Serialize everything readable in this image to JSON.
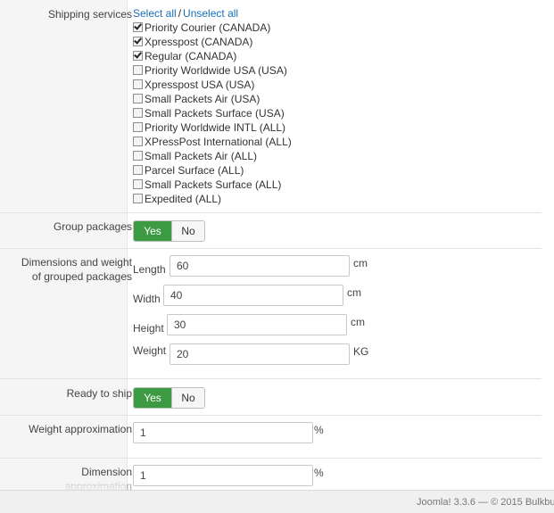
{
  "shipping_services": {
    "label": "Shipping services",
    "select_all": "Select all",
    "separator": "/",
    "unselect_all": "Unselect all",
    "items": [
      {
        "label": "Priority Courier (CANADA)",
        "checked": true
      },
      {
        "label": "Xpresspost (CANADA)",
        "checked": true
      },
      {
        "label": "Regular (CANADA)",
        "checked": true
      },
      {
        "label": "Priority Worldwide USA (USA)",
        "checked": false
      },
      {
        "label": "Xpresspost USA (USA)",
        "checked": false
      },
      {
        "label": "Small Packets Air (USA)",
        "checked": false
      },
      {
        "label": "Small Packets Surface (USA)",
        "checked": false
      },
      {
        "label": "Priority Worldwide INTL (ALL)",
        "checked": false
      },
      {
        "label": "XPressPost International (ALL)",
        "checked": false
      },
      {
        "label": "Small Packets Air (ALL)",
        "checked": false
      },
      {
        "label": "Parcel Surface (ALL)",
        "checked": false
      },
      {
        "label": "Small Packets Surface (ALL)",
        "checked": false
      },
      {
        "label": "Expedited (ALL)",
        "checked": false
      }
    ]
  },
  "group_packages": {
    "label": "Group packages",
    "yes": "Yes",
    "no": "No",
    "selected": "Yes"
  },
  "dimensions": {
    "label_line1": "Dimensions and weight",
    "label_line2": "of grouped packages",
    "length_label": "Length",
    "length_value": "60",
    "length_unit": "cm",
    "width_label": "Width",
    "width_value": "40",
    "width_unit": "cm",
    "height_label": "Height",
    "height_value": "30",
    "height_unit": "cm",
    "weight_label": "Weight",
    "weight_value": "20",
    "weight_unit": "KG"
  },
  "ready_to_ship": {
    "label": "Ready to ship",
    "yes": "Yes",
    "no": "No",
    "selected": "Yes"
  },
  "weight_approximation": {
    "label": "Weight approximation",
    "value": "1",
    "unit": "%"
  },
  "dimension_approximation": {
    "label_line1": "Dimension",
    "label_line2": "approximation",
    "value": "1",
    "unit": "%"
  },
  "footer": {
    "text": "Joomla! 3.3.6 — © 2015 Bulkbu"
  },
  "colors": {
    "accent_green": "#3c9a42",
    "link_blue": "#1a6fb8"
  }
}
